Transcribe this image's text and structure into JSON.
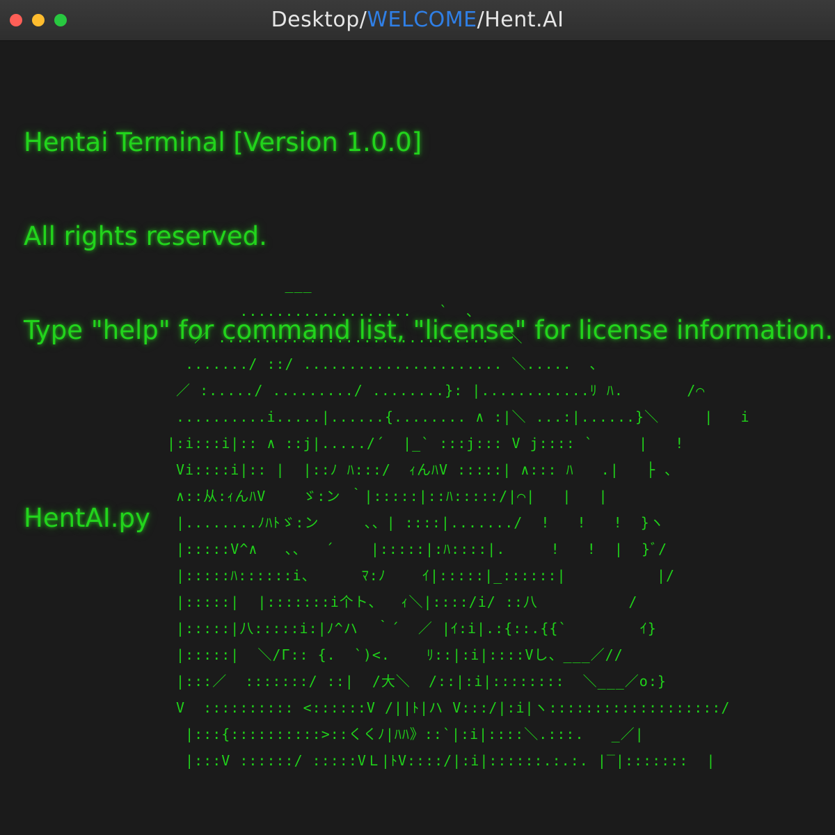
{
  "window": {
    "title_prefix": "Desktop/",
    "title_highlight": "WELCOME",
    "title_suffix": "/Hent.AI"
  },
  "terminal": {
    "lines": [
      "Hentai Terminal [Version 1.0.0]",
      "All rights reserved.",
      "Type \"help\" for command list, \"license\" for license information.",
      "",
      "HentAI.py"
    ],
    "ascii_art": "             ___\n        ...................   `  ､\n   ／ ..............................  ＼\n  ......./ ::/ ...................... ＼.....  ､\n ／ :...../ ........./ ........}: |............ﾘ ﾊ.       /⌒\n ..........i.....|......{........ ∧ :|＼ ...:|......}＼     |   i\n|:i:::i|:: ∧ ::j|...../´  |_` :::j::: V j:::: `     |   !\n Vi::::i|:: |  |::ﾉ ﾊ:::/  ｨんﾊV :::::| ∧::: ﾊ   .|   ├ 、\n ∧::从:ｨんﾊV    ゞ:ン ｀|:::::|::ﾊ:::::/|⌒|   |   |\n |........ﾉﾊﾄゞ:ン     、、| ::::|......./  !   !   !  }ヽ\n |:::::V^∧   、、  ´    |:::::|:ﾊ::::|.     !   !  |  }ﾞ/\n |:::::ﾊ::::::i、     ﾏ:ﾉ    ｲ|:::::|_::::::|          |/\n |:::::|  |:::::::i个ト、  ｨ＼|::::/i/ ::八          /\n |:::::|八:::::i:|ﾉ^ハ  ｀´  ／ |ｲ:i|.:{::.{{`        ｲ}\n |:::::|  ＼/Γ:: {.  `)<.    ﾘ::|:i|::::Vし、___／//\n |:::／  :::::::/ ::|  /大＼  /::|:i|::::::::  ＼___／o:}\n V  :::::::::: <::::::V /||ﾄ|ハ V:::/|:i|ヽ:::::::::::::::::::/\n  |:::{::::::::::>::くくﾉ|ﾊﾊ》::`|:i|::::＼.:::.   _／|\n  |:::V ::::::/ :::::VＬ|ﾄV::::/|:i|::::::.:.:. |‾|:::::::  |"
  },
  "colors": {
    "terminal_green": "#22d41c",
    "title_text": "#e6e6e6",
    "title_highlight": "#2f7fe6",
    "background": "#1b1b1b",
    "close": "#fe5f57",
    "minimize": "#febc2e",
    "maximize": "#28c840"
  }
}
